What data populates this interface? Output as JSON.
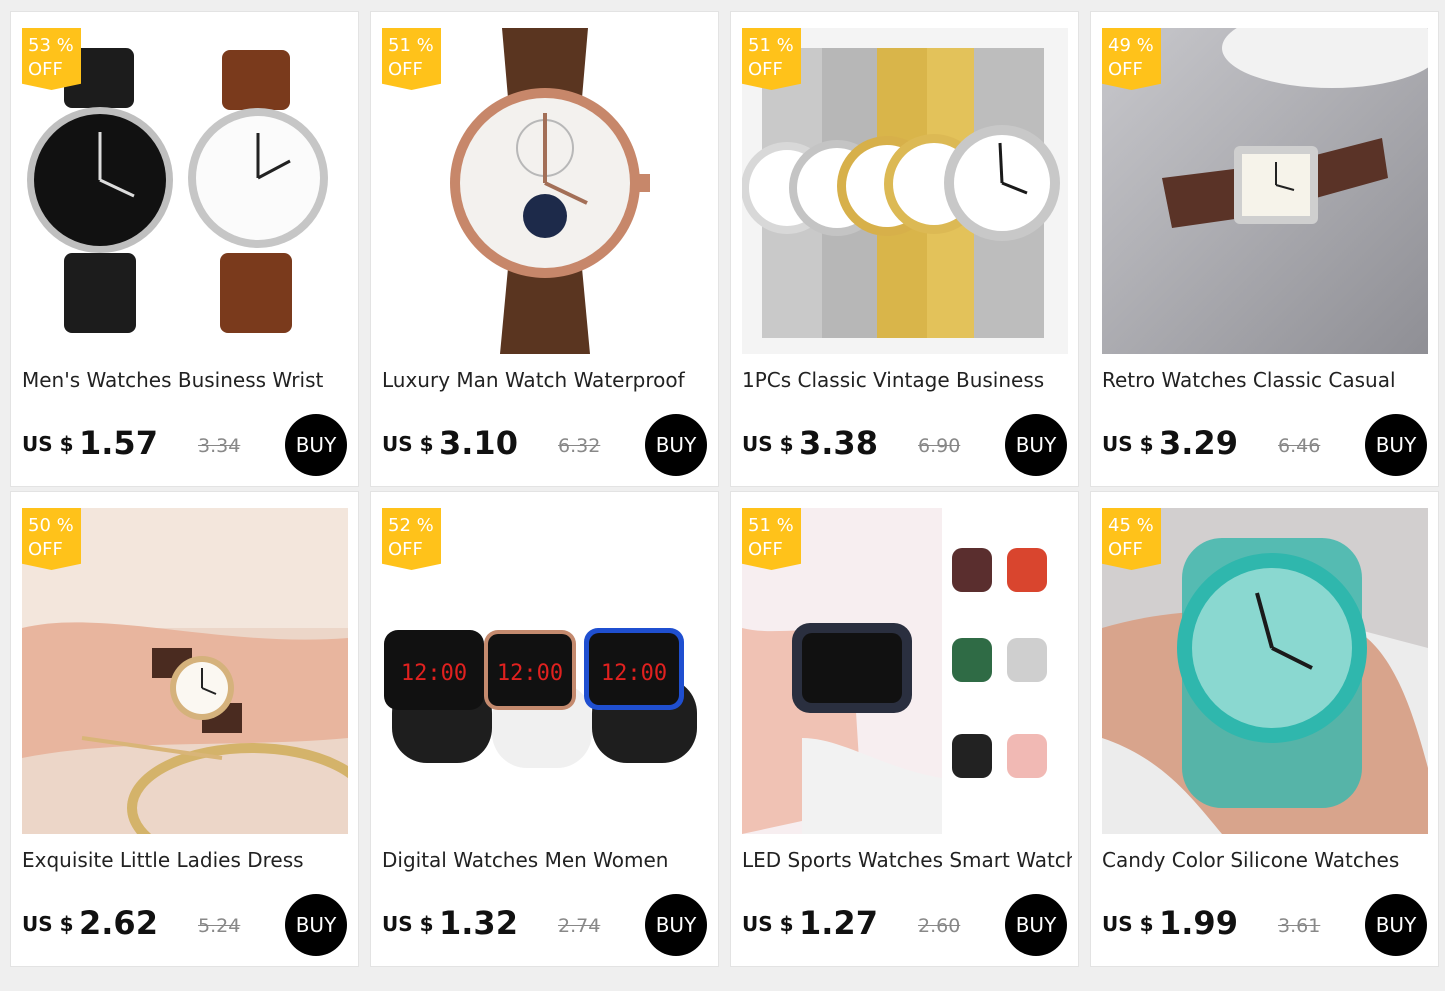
{
  "products": [
    {
      "discount": "53 %",
      "off": "OFF",
      "title": "Men's Watches Business Wrist",
      "currency": "US $",
      "price": "1.57",
      "old_price": "3.34",
      "buy": "BUY",
      "image_icon": "leather-watch-pair-image",
      "bg": "#ffffff"
    },
    {
      "discount": "51 %",
      "off": "OFF",
      "title": "Luxury Man Watch Waterproof",
      "currency": "US $",
      "price": "3.10",
      "old_price": "6.32",
      "buy": "BUY",
      "image_icon": "luxury-watch-image",
      "bg": "#ffffff"
    },
    {
      "discount": "51 %",
      "off": "OFF",
      "title": "1PCs Classic Vintage Business",
      "currency": "US $",
      "price": "3.38",
      "old_price": "6.90",
      "buy": "BUY",
      "image_icon": "expansion-band-watches-image",
      "bg": "#f4f4f4"
    },
    {
      "discount": "49 %",
      "off": "OFF",
      "title": "Retro Watches Classic Casual",
      "currency": "US $",
      "price": "3.29",
      "old_price": "6.46",
      "buy": "BUY",
      "image_icon": "rectangular-retro-watch-image",
      "bg": "#a9a9ae"
    },
    {
      "discount": "50 %",
      "off": "OFF",
      "title": "Exquisite Little Ladies Dress",
      "currency": "US $",
      "price": "2.62",
      "old_price": "5.24",
      "buy": "BUY",
      "image_icon": "ladies-wrist-watch-image",
      "bg": "#ecd6c8"
    },
    {
      "discount": "52 %",
      "off": "OFF",
      "title": "Digital Watches Men Women",
      "currency": "US $",
      "price": "1.32",
      "old_price": "2.74",
      "buy": "BUY",
      "image_icon": "led-digital-watches-image",
      "bg": "#ffffff"
    },
    {
      "discount": "51 %",
      "off": "OFF",
      "title": "LED Sports Watches Smart Watch",
      "currency": "US $",
      "price": "1.27",
      "old_price": "2.60",
      "buy": "BUY",
      "image_icon": "smart-sports-watches-image",
      "bg": "#f7eef0"
    },
    {
      "discount": "45 %",
      "off": "OFF",
      "title": "Candy Color Silicone Watches",
      "currency": "US $",
      "price": "1.99",
      "old_price": "3.61",
      "buy": "BUY",
      "image_icon": "transparent-silicone-watch-image",
      "bg": "#d2cfcf"
    }
  ],
  "clock_digits": "12:00"
}
